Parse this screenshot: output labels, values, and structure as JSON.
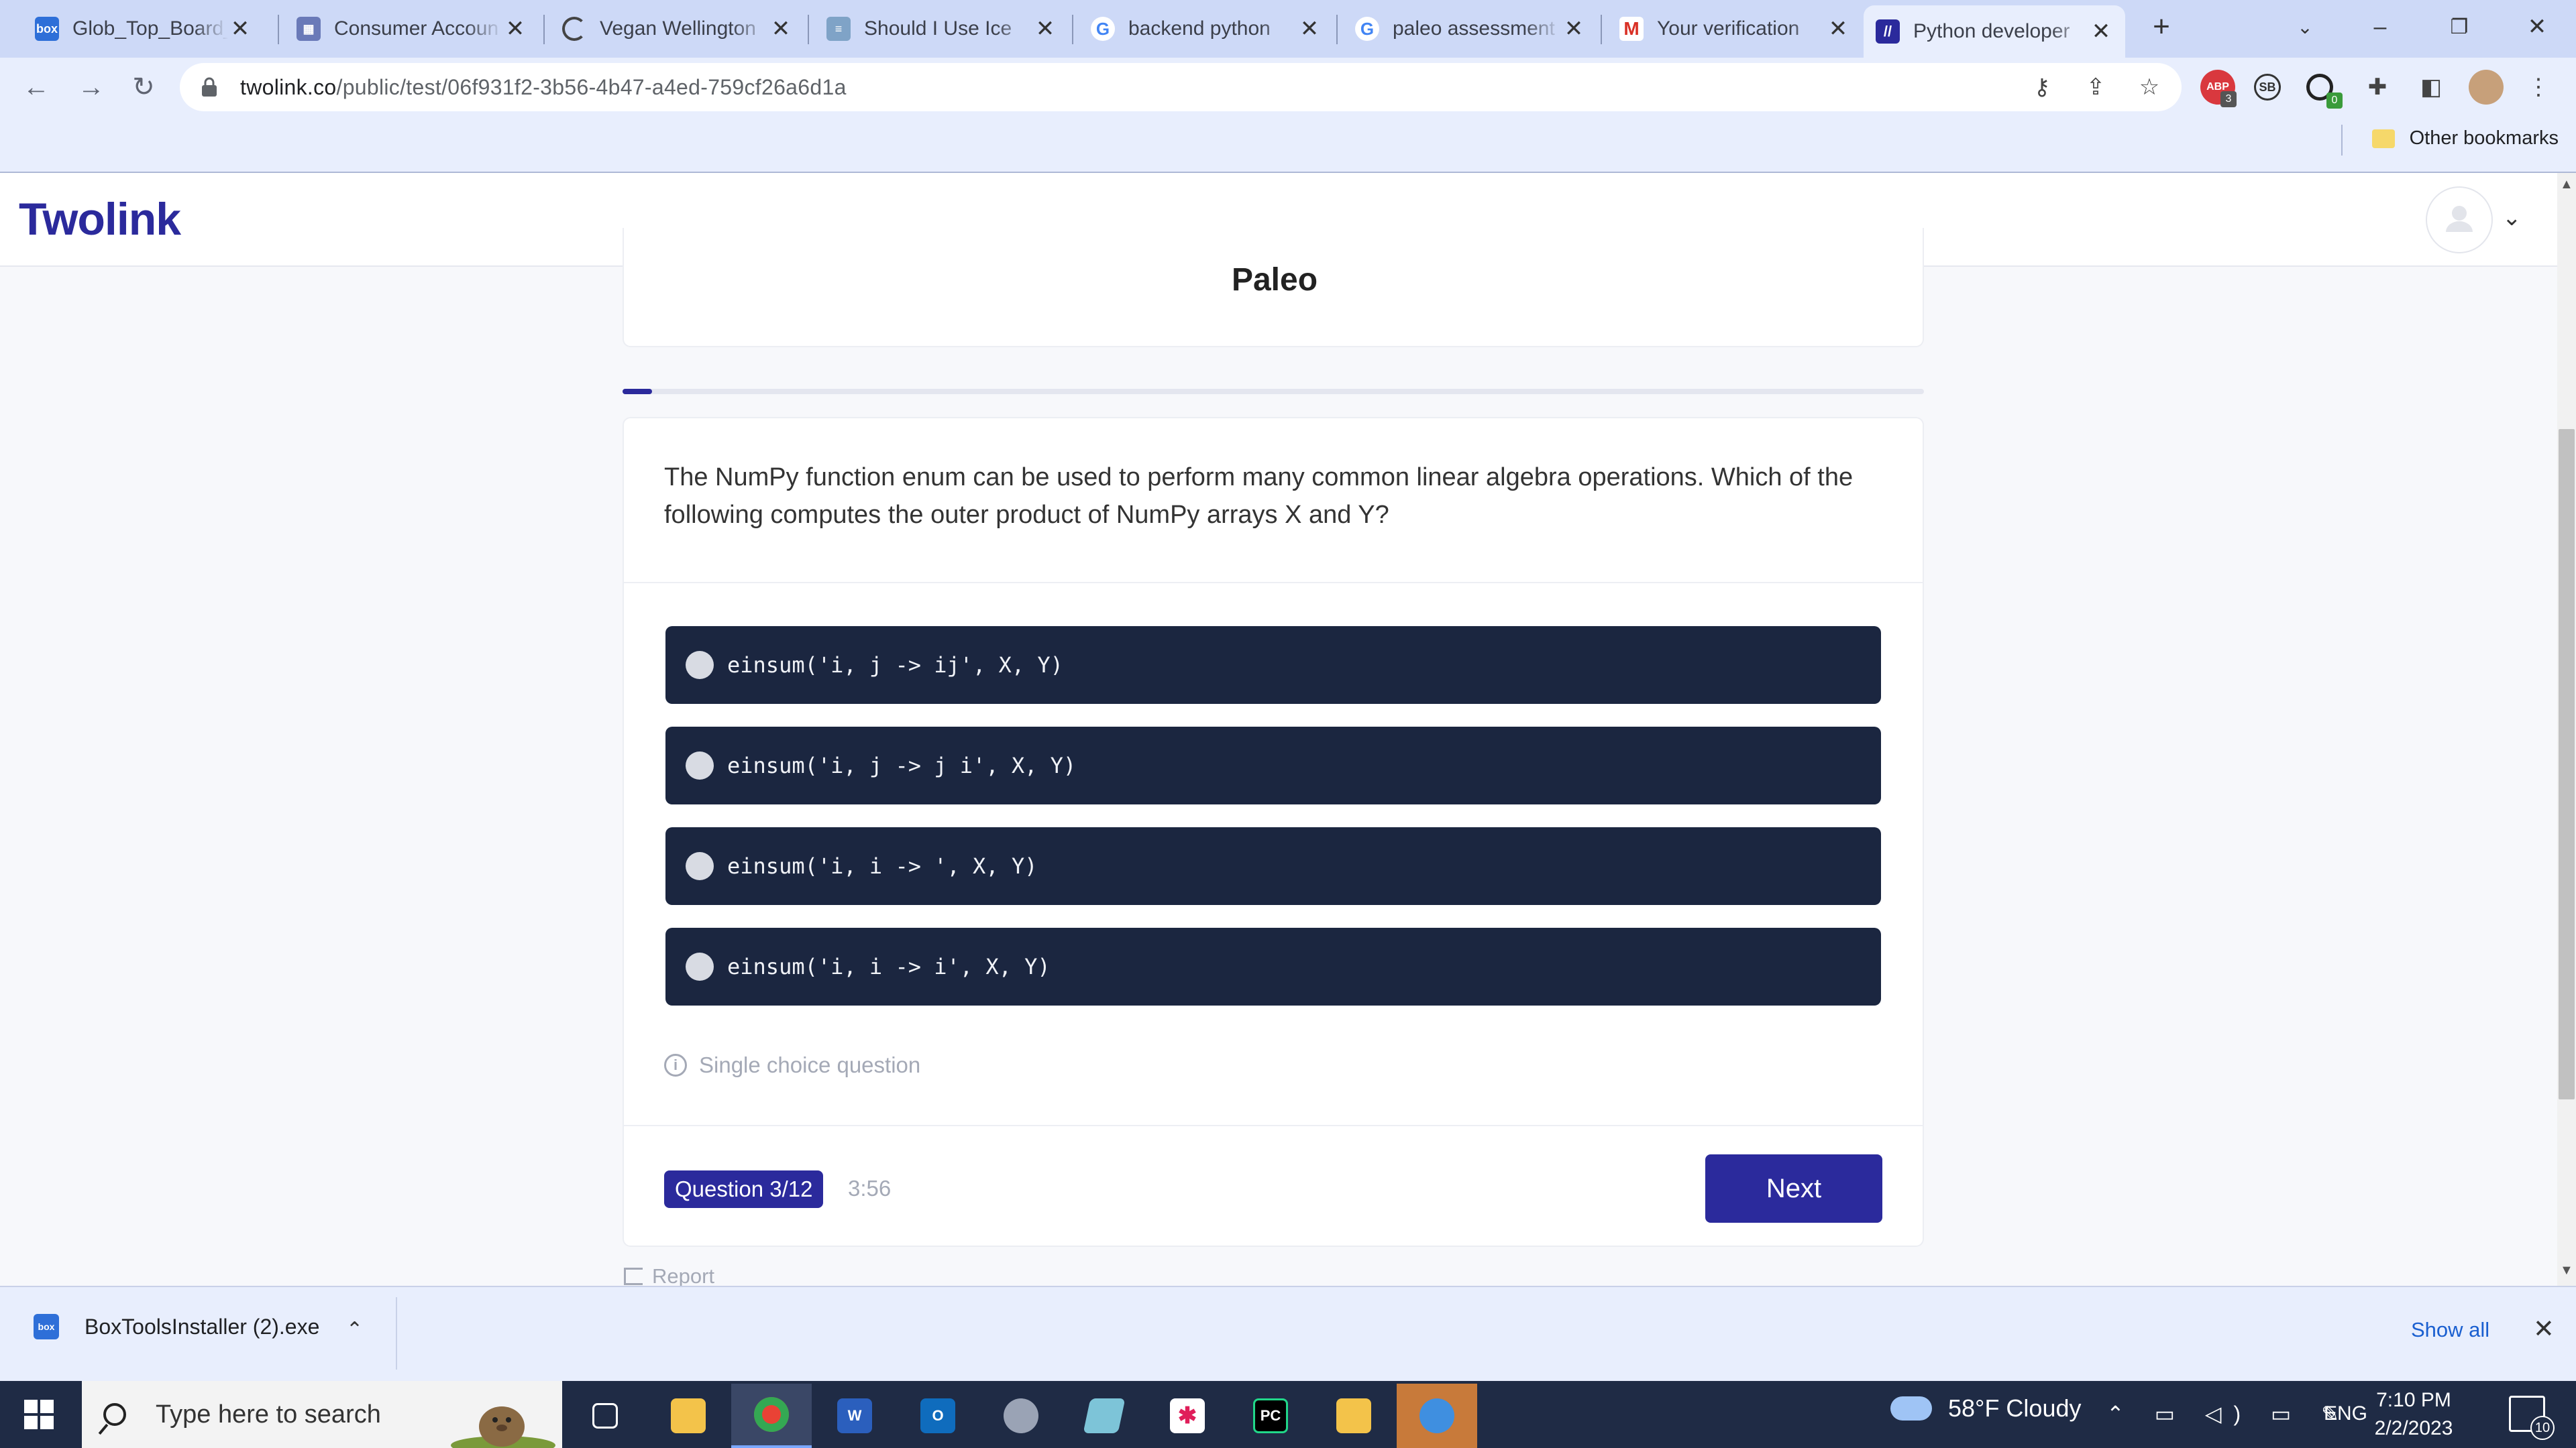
{
  "browser": {
    "tabs": [
      {
        "title": "Glob_Top_Board_",
        "icon": "box-icon",
        "color": "#2e6fd8"
      },
      {
        "title": "Consumer Accoun",
        "icon": "building-icon",
        "color": "#6a7ab8"
      },
      {
        "title": "Vegan Wellington",
        "icon": "spinner-icon",
        "color": "#444444"
      },
      {
        "title": "Should I Use Ice",
        "icon": "document-icon",
        "color": "#7fa3c7"
      },
      {
        "title": "backend python",
        "icon": "google-icon",
        "color": "#4285f4"
      },
      {
        "title": "paleo assessment",
        "icon": "google-icon",
        "color": "#4285f4"
      },
      {
        "title": "Your verification",
        "icon": "gmail-icon",
        "color": "#d93025"
      },
      {
        "title": "Python developer",
        "icon": "twolink-icon",
        "color": "#2b2a9c",
        "active": true
      }
    ],
    "new_tab_symbol": "+",
    "url_host": "twolink.co",
    "url_path": "/public/test/06f931f2-3b56-4b47-a4ed-759cf26a6d1a",
    "other_bookmarks_label": "Other bookmarks"
  },
  "site": {
    "logo_text": "Twolink"
  },
  "test": {
    "title": "Paleo",
    "progress_fraction": 0.0227,
    "question": "The NumPy function enum can be used to perform many common linear algebra operations. Which of the following computes the outer product of NumPy arrays X and Y?",
    "answers": [
      "einsum('i, j -> ij', X, Y)",
      "einsum('i, j -> j i', X, Y)",
      "einsum('i, i -> ', X, Y)",
      "einsum('i, i -> i', X, Y)"
    ],
    "hint": "Single choice question",
    "question_counter": "Question 3/12",
    "timer": "3:56",
    "next_label": "Next",
    "report_label": "Report"
  },
  "downloads": {
    "file_name": "BoxToolsInstaller (2).exe",
    "show_all_label": "Show all"
  },
  "taskbar": {
    "search_placeholder": "Type here to search",
    "weather": "58°F  Cloudy",
    "language": "ENG",
    "time": "7:10 PM",
    "date": "2/2/2023",
    "notification_count": "10"
  },
  "extensions": {
    "abp_badge": "3",
    "sb_label": "SB",
    "green_badge": "0"
  },
  "colors": {
    "brand": "#2b2a9c",
    "answer_bg": "#1b2640",
    "tab_strip": "#cdd9f7"
  }
}
